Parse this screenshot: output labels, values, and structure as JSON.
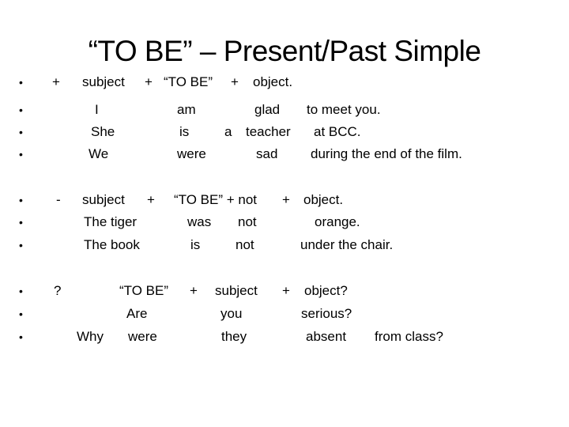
{
  "title": "“TO BE” – Present/Past Simple",
  "bullet_symbol": "•",
  "rows": [
    [
      "+",
      "subject",
      "+",
      "“TO BE”",
      "+",
      "object."
    ],
    [
      "I",
      "am",
      "glad",
      "to meet you."
    ],
    [
      "She",
      "is",
      "a",
      "teacher",
      "at BCC."
    ],
    [
      "We",
      "were",
      "sad",
      "during the end of the film."
    ],
    [
      "-",
      "subject",
      "+",
      "“TO BE” + not",
      "+",
      "object."
    ],
    [
      "The tiger",
      "was",
      "not",
      "orange."
    ],
    [
      "The book",
      "is",
      "not",
      "under the chair."
    ],
    [
      "?",
      "“TO BE”",
      "+",
      "subject",
      "+",
      "object?"
    ],
    [
      "Are",
      "you",
      "serious?"
    ],
    [
      "Why",
      "were",
      "they",
      "absent",
      "from class?"
    ]
  ]
}
